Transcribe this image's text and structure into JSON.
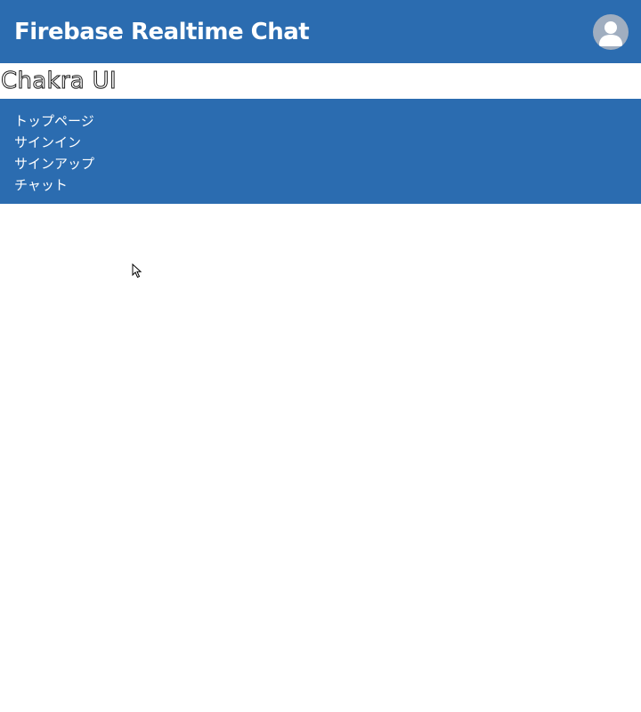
{
  "header": {
    "title": "Firebase Realtime Chat",
    "avatar_icon": "user-avatar-icon",
    "background_color": "#2b6cb0"
  },
  "brand": {
    "text": "Chakra UI"
  },
  "nav": {
    "items": [
      {
        "label": "トップページ"
      },
      {
        "label": "サインイン"
      },
      {
        "label": "サインアップ"
      },
      {
        "label": "チャット"
      }
    ]
  },
  "colors": {
    "primary": "#2b6cb0",
    "avatar_bg": "#a0aec0",
    "text_on_primary": "#ffffff"
  }
}
